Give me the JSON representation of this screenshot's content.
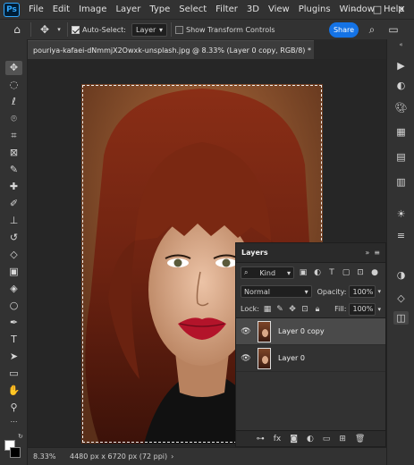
{
  "app": {
    "logo": "Ps"
  },
  "menu": [
    "File",
    "Edit",
    "Image",
    "Layer",
    "Type",
    "Select",
    "Filter",
    "3D",
    "View",
    "Plugins",
    "Window",
    "Help"
  ],
  "window_controls": {
    "minimize": "–",
    "maximize": "□",
    "close": "✕"
  },
  "options": {
    "auto_select_label": "Auto-Select:",
    "auto_select_value": "Layer",
    "show_transform_label": "Show Transform Controls",
    "share_label": "Share"
  },
  "document": {
    "tab_title": "pouriya-kafaei-dNmmjX2Owxk-unsplash.jpg @ 8.33% (Layer 0 copy, RGB/8) *",
    "close": "×"
  },
  "status": {
    "zoom": "8.33%",
    "doc_info": "4480 px x 6720 px (72 ppi)",
    "arrow": "›"
  },
  "layers_panel": {
    "title": "Layers",
    "kind_label": "Kind",
    "blend_mode": "Normal",
    "opacity_label": "Opacity:",
    "opacity_value": "100%",
    "lock_label": "Lock:",
    "fill_label": "Fill:",
    "fill_value": "100%",
    "layers": [
      {
        "name": "Layer 0 copy",
        "visible": true,
        "active": true
      },
      {
        "name": "Layer 0",
        "visible": true,
        "active": false
      }
    ]
  },
  "colors": {
    "accent": "#1473e6",
    "panel_bg": "#323232",
    "canvas_bg": "#262626",
    "selected_layer": "#4a4a4a"
  }
}
